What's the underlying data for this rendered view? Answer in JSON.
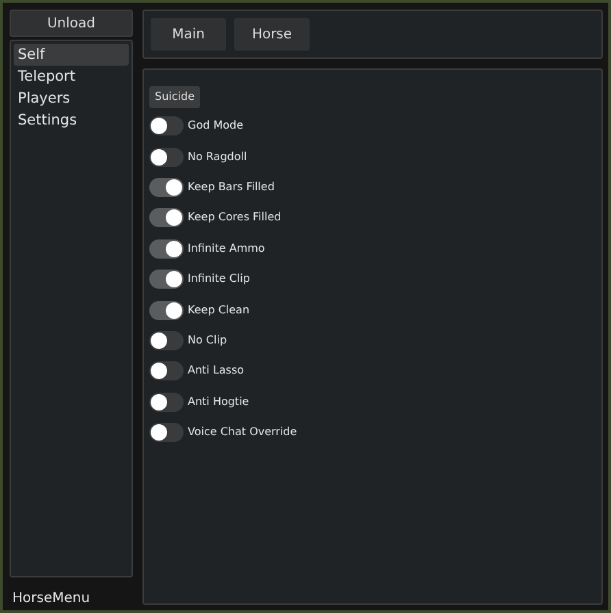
{
  "unload_button": "Unload",
  "sidebar": {
    "items": [
      {
        "label": "Self",
        "selected": true
      },
      {
        "label": "Teleport",
        "selected": false
      },
      {
        "label": "Players",
        "selected": false
      },
      {
        "label": "Settings",
        "selected": false
      }
    ]
  },
  "footer": "HorseMenu",
  "tabs": [
    {
      "label": "Main",
      "selected": false
    },
    {
      "label": "Horse",
      "selected": false
    }
  ],
  "content": {
    "action_button": "Suicide",
    "toggles": [
      {
        "label": "God Mode",
        "on": false
      },
      {
        "label": "No Ragdoll",
        "on": false
      },
      {
        "label": "Keep Bars Filled",
        "on": true
      },
      {
        "label": "Keep Cores Filled",
        "on": true
      },
      {
        "label": "Infinite Ammo",
        "on": true
      },
      {
        "label": "Infinite Clip",
        "on": true
      },
      {
        "label": "Keep Clean",
        "on": true
      },
      {
        "label": "No Clip",
        "on": false
      },
      {
        "label": "Anti Lasso",
        "on": false
      },
      {
        "label": "Anti Hogtie",
        "on": false
      },
      {
        "label": "Voice Chat Override",
        "on": false
      }
    ]
  }
}
